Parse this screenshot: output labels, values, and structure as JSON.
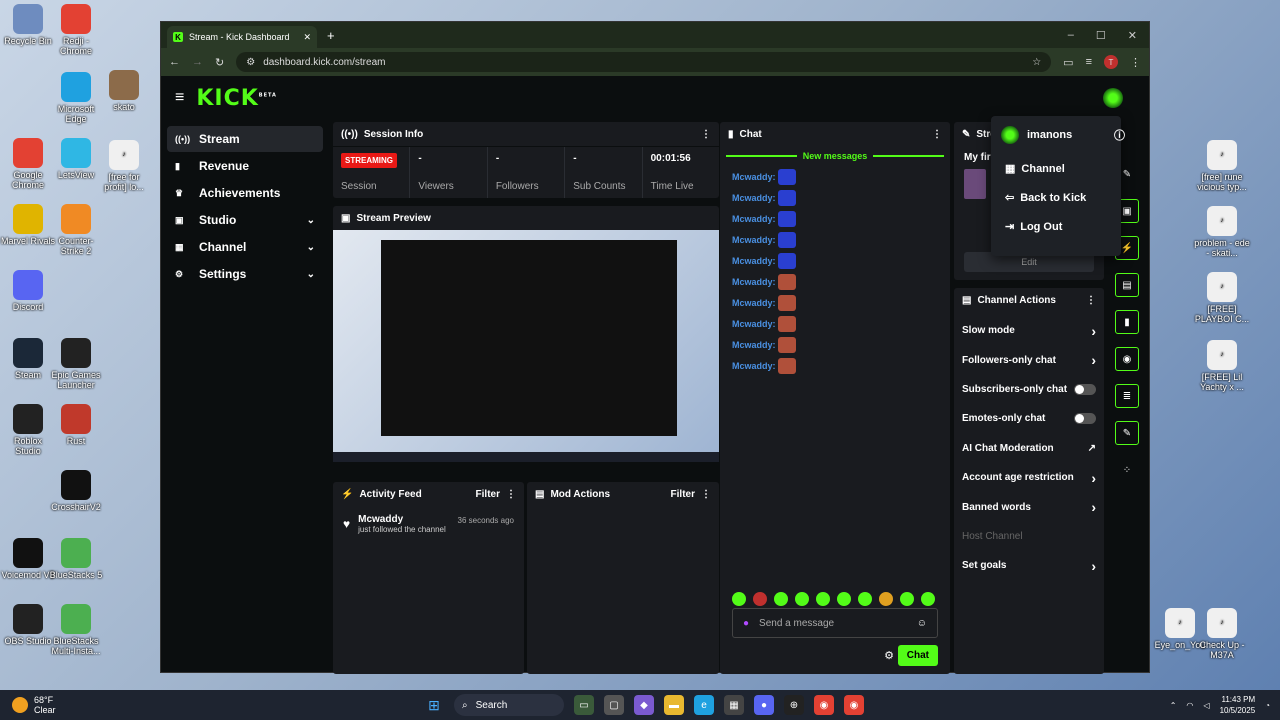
{
  "desktop": {
    "icons": [
      {
        "label": "Recycle Bin",
        "icon": "recycle-bin-icon",
        "color": "#6e8cbf"
      },
      {
        "label": "Redji - Chrome",
        "icon": "chrome-icon",
        "color": "#e34133"
      },
      {
        "label": "Microsoft Edge",
        "icon": "edge-icon",
        "color": "#1fa1e0"
      },
      {
        "label": "skato",
        "icon": "folder-icon",
        "color": "#8c6b4a"
      },
      {
        "label": "Google Chrome",
        "icon": "chrome-icon",
        "color": "#e34133"
      },
      {
        "label": "LetsView",
        "icon": "letsview-icon",
        "color": "#2fb7e4"
      },
      {
        "label": "[free for profit] lo...",
        "icon": "mp3-file-icon",
        "color": "#f0f0f0"
      },
      {
        "label": "Marvel Rivals",
        "icon": "marvel-rivals-icon",
        "color": "#e0b400"
      },
      {
        "label": "Counter-Strike 2",
        "icon": "cs2-icon",
        "color": "#f08a24"
      },
      {
        "label": "Discord",
        "icon": "discord-icon",
        "color": "#5865f2"
      },
      {
        "label": "Steam",
        "icon": "steam-icon",
        "color": "#1b2838"
      },
      {
        "label": "Epic Games Launcher",
        "icon": "epic-icon",
        "color": "#222"
      },
      {
        "label": "Roblox Studio",
        "icon": "roblox-icon",
        "color": "#222"
      },
      {
        "label": "Rust",
        "icon": "rust-icon",
        "color": "#c0392b"
      },
      {
        "label": "CrosshairV2",
        "icon": "crosshair-icon",
        "color": "#111"
      },
      {
        "label": "Voicemod V3",
        "icon": "voicemod-icon",
        "color": "#111"
      },
      {
        "label": "BlueStacks 5",
        "icon": "bluestacks-icon",
        "color": "#4caf50"
      },
      {
        "label": "OBS Studio",
        "icon": "obs-icon",
        "color": "#222"
      },
      {
        "label": "BlueStacks Multi-Insta...",
        "icon": "bluestacks-icon",
        "color": "#4caf50"
      },
      {
        "label": "[free] rune vicious typ...",
        "icon": "mp3-file-icon",
        "color": "#f0f0f0"
      },
      {
        "label": "problem - ede - skati...",
        "icon": "mp3-file-icon",
        "color": "#f0f0f0"
      },
      {
        "label": "[FREE] PLAYBOI C...",
        "icon": "mp3-file-icon",
        "color": "#f0f0f0"
      },
      {
        "label": "[FREE] Lil Yachty x ...",
        "icon": "mp3-file-icon",
        "color": "#f0f0f0"
      },
      {
        "label": "Eye_on_You",
        "icon": "wav-file-icon",
        "color": "#f0f0f0"
      },
      {
        "label": "Check Up - M37A",
        "icon": "mp3-file-icon",
        "color": "#f0f0f0"
      }
    ]
  },
  "browser": {
    "tab_title": "Stream - Kick Dashboard",
    "url": "dashboard.kick.com/stream",
    "profile_initial": "T"
  },
  "kick": {
    "logo": "KICK",
    "logo_badge": "BETA",
    "sidebar": [
      {
        "label": "Stream",
        "icon": "stream-icon",
        "active": true,
        "chevron": false
      },
      {
        "label": "Revenue",
        "icon": "revenue-icon",
        "active": false,
        "chevron": false
      },
      {
        "label": "Achievements",
        "icon": "trophy-icon",
        "active": false,
        "chevron": false
      },
      {
        "label": "Studio",
        "icon": "studio-icon",
        "active": false,
        "chevron": true
      },
      {
        "label": "Channel",
        "icon": "channel-icon",
        "active": false,
        "chevron": true
      },
      {
        "label": "Settings",
        "icon": "gear-icon",
        "active": false,
        "chevron": true
      }
    ],
    "session": {
      "title": "Session Info",
      "status": "STREAMING",
      "session_label": "Session",
      "stats": [
        {
          "value": "-",
          "label": "Viewers"
        },
        {
          "value": "-",
          "label": "Followers"
        },
        {
          "value": "-",
          "label": "Sub Counts"
        },
        {
          "value": "00:01:56",
          "label": "Time Live"
        }
      ]
    },
    "preview": {
      "title": "Stream Preview"
    },
    "activity": {
      "title": "Activity Feed",
      "filter": "Filter",
      "item_name": "Mcwaddy",
      "item_text": "just followed the channel",
      "item_time": "36 seconds ago"
    },
    "mod": {
      "title": "Mod Actions",
      "filter": "Filter"
    },
    "chat": {
      "title": "Chat",
      "new_messages": "New messages",
      "user": "Mcwaddy:",
      "messages": 10,
      "input_placeholder": "Send a message",
      "send": "Chat"
    },
    "stream_panel": {
      "title": "Stre",
      "subtitle": "My fir",
      "edit": "Edit"
    },
    "actions": {
      "title": "Channel Actions",
      "items": [
        {
          "label": "Slow mode",
          "control": "chevron"
        },
        {
          "label": "Followers-only chat",
          "control": "chevron"
        },
        {
          "label": "Subscribers-only chat",
          "control": "toggle"
        },
        {
          "label": "Emotes-only chat",
          "control": "toggle"
        },
        {
          "label": "AI Chat Moderation",
          "control": "external"
        },
        {
          "label": "Account age restriction",
          "control": "chevron"
        },
        {
          "label": "Banned words",
          "control": "chevron"
        },
        {
          "label": "Host Channel",
          "control": "none"
        },
        {
          "label": "Set goals",
          "control": "chevron"
        }
      ]
    },
    "dropdown": {
      "username": "imanons",
      "items": [
        {
          "label": "Channel",
          "icon": "channel-icon"
        },
        {
          "label": "Back to Kick",
          "icon": "back-icon"
        },
        {
          "label": "Log Out",
          "icon": "logout-icon"
        }
      ]
    }
  },
  "taskbar": {
    "weather_temp": "68°F",
    "weather_desc": "Clear",
    "search": "Search",
    "time": "11:43 PM",
    "date": "10/5/2025"
  }
}
